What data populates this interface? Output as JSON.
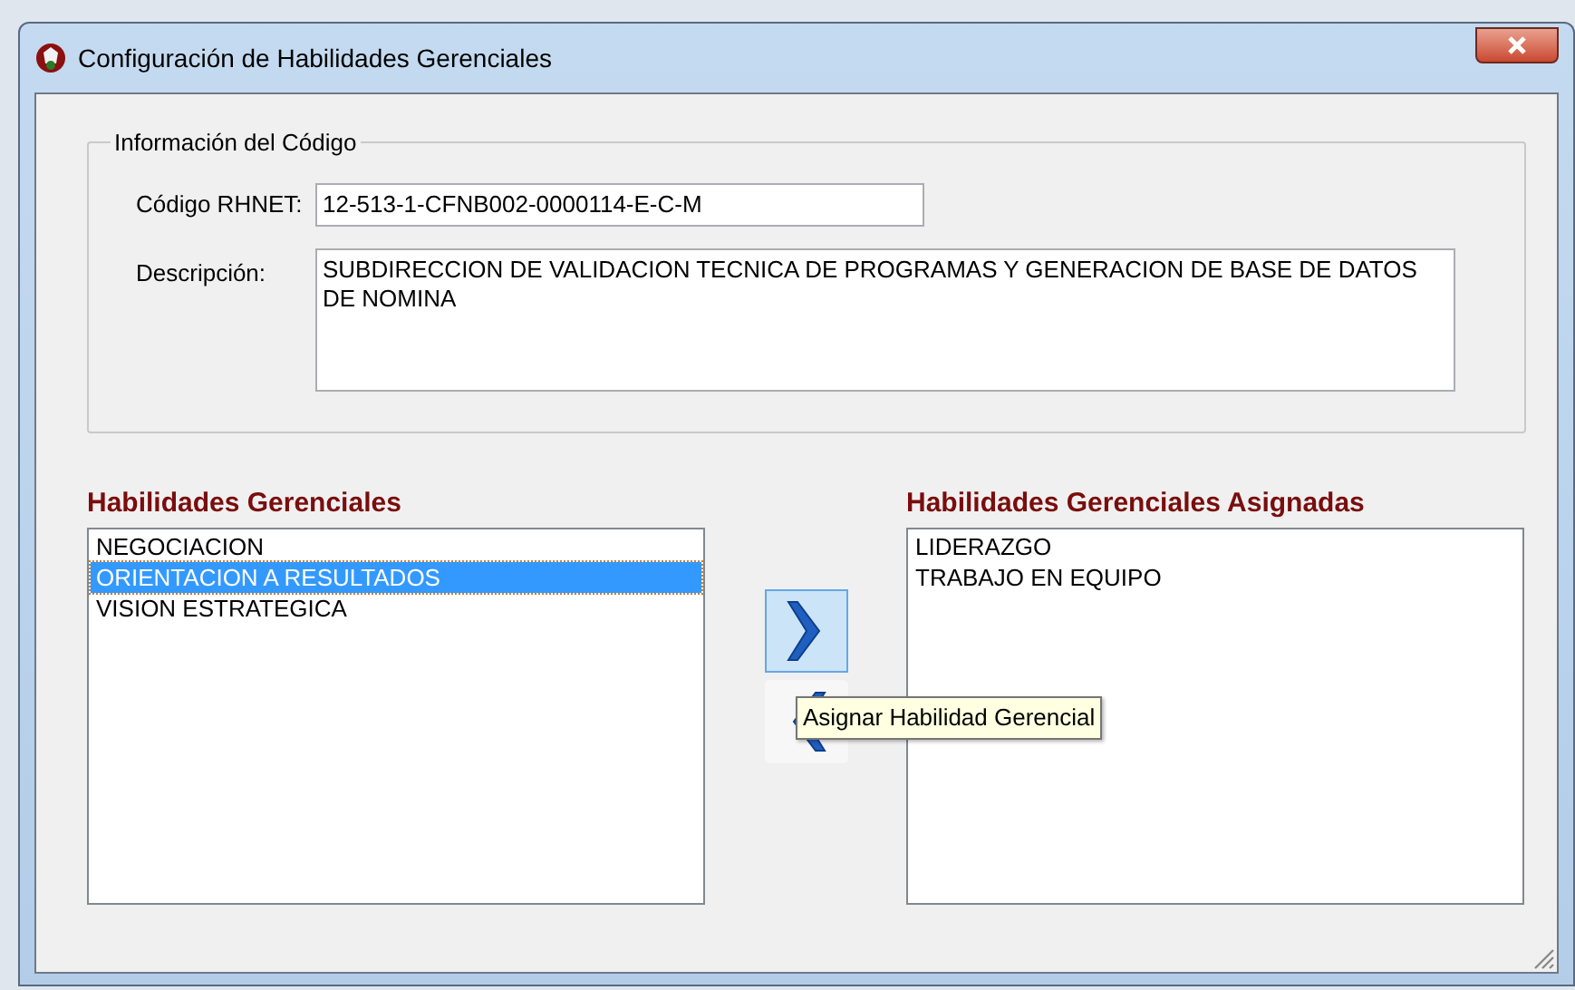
{
  "window": {
    "title": "Configuración de Habilidades Gerenciales"
  },
  "info_group": {
    "title": "Información del Código",
    "code": {
      "label": "Código RHNET:",
      "value": "12-513-1-CFNB002-0000114-E-C-M"
    },
    "description": {
      "label": "Descripción:",
      "value": "SUBDIRECCION DE VALIDACION TECNICA DE PROGRAMAS Y GENERACION DE BASE DE DATOS DE NOMINA"
    }
  },
  "available": {
    "title": "Habilidades Gerenciales",
    "items": [
      {
        "text": "NEGOCIACION",
        "selected": false
      },
      {
        "text": "ORIENTACION A RESULTADOS",
        "selected": true
      },
      {
        "text": "VISION ESTRATEGICA",
        "selected": false
      }
    ]
  },
  "move_buttons": [
    {
      "kind": "assign",
      "hovered": true
    },
    {
      "kind": "remove",
      "hovered": false
    }
  ],
  "tooltip": "Asignar Habilidad Gerencial",
  "assigned": {
    "title": "Habilidades Gerenciales Asignadas",
    "items": [
      {
        "text": "LIDERAZGO",
        "selected": false
      },
      {
        "text": "TRABAJO EN EQUIPO",
        "selected": false
      }
    ]
  }
}
